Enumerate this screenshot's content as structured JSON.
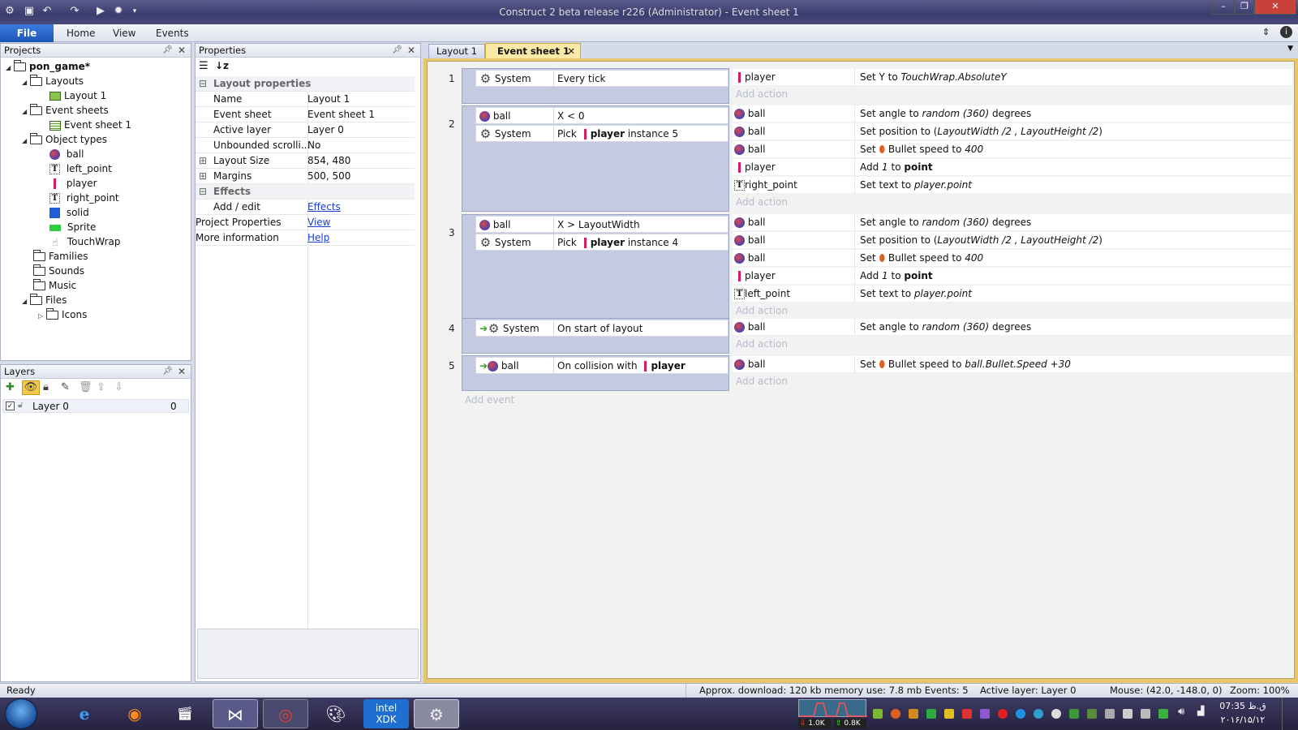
{
  "window": {
    "title": "Construct 2 beta release r226 (Administrator) - Event sheet 1",
    "min": "–",
    "max": "❐",
    "close": "✕"
  },
  "ribbon": {
    "file": "File",
    "tabs": [
      "Home",
      "View",
      "Events"
    ]
  },
  "projects": {
    "header": "Projects",
    "root": "pon_game*",
    "layouts_folder": "Layouts",
    "layout1": "Layout 1",
    "eventsheets_folder": "Event sheets",
    "eventsheet1": "Event sheet 1",
    "objecttypes_folder": "Object types",
    "objects": [
      "ball",
      "left_point",
      "player",
      "right_point",
      "solid",
      "Sprite",
      "TouchWrap"
    ],
    "families": "Families",
    "sounds": "Sounds",
    "music": "Music",
    "files": "Files",
    "icons": "Icons"
  },
  "layers": {
    "header": "Layers",
    "layer_name": "Layer 0",
    "layer_num": "0"
  },
  "properties": {
    "header": "Properties",
    "section_layout": "Layout properties",
    "rows": [
      {
        "k": "Name",
        "v": "Layout 1"
      },
      {
        "k": "Event sheet",
        "v": "Event sheet 1"
      },
      {
        "k": "Active layer",
        "v": "Layer 0"
      },
      {
        "k": "Unbounded scrolli...",
        "v": "No"
      },
      {
        "k": "Layout Size",
        "v": "854, 480"
      },
      {
        "k": "Margins",
        "v": "500, 500"
      }
    ],
    "section_effects": "Effects",
    "addedit": "Add / edit",
    "effects_link": "Effects",
    "project_props": "Project Properties",
    "view_link": "View",
    "more_info": "More information",
    "help_link": "Help"
  },
  "doc_tabs": [
    "Layout 1",
    "Event sheet 1"
  ],
  "events": {
    "add_action": "Add action",
    "add_event": "Add event",
    "e1": {
      "num": "1",
      "c1_obj": "System",
      "c1_txt": "Every tick",
      "a1_obj": "player",
      "a1_pre": "Set Y to ",
      "a1_it": "TouchWrap.AbsoluteY"
    },
    "e2": {
      "num": "2",
      "c1_obj": "ball",
      "c1_txt": "X < 0",
      "c2_obj": "System",
      "c2_pick": "Pick",
      "c2_b": "player",
      "c2_rest": " instance 5",
      "acts": [
        {
          "obj": "ball",
          "pre": "Set angle to ",
          "it": "random (360)",
          "post": "  degrees"
        },
        {
          "obj": "ball",
          "pre": "Set position to (",
          "it": "LayoutWidth /2 , LayoutHeight /2",
          "post": ")"
        },
        {
          "obj": "ball",
          "pre": "Set ",
          "mid": "Bullet speed to ",
          "it": "400",
          "post": ""
        },
        {
          "obj": "player",
          "pre": "Add ",
          "it": "1",
          "post": " to ",
          "b": "point"
        },
        {
          "obj": "right_point",
          "pre": "Set text to ",
          "it": "player.point",
          "post": ""
        }
      ]
    },
    "e3": {
      "num": "3",
      "c1_obj": "ball",
      "c1_txt": "X > LayoutWidth",
      "c2_obj": "System",
      "c2_pick": "Pick",
      "c2_b": "player",
      "c2_rest": " instance 4",
      "acts": [
        {
          "obj": "ball",
          "pre": "Set angle to ",
          "it": "random (360)",
          "post": "  degrees"
        },
        {
          "obj": "ball",
          "pre": "Set position to (",
          "it": "LayoutWidth /2 , LayoutHeight /2",
          "post": ")"
        },
        {
          "obj": "ball",
          "pre": "Set ",
          "mid": "Bullet speed to ",
          "it": "400",
          "post": ""
        },
        {
          "obj": "player",
          "pre": "Add ",
          "it": "1",
          "post": " to ",
          "b": "point"
        },
        {
          "obj": "left_point",
          "pre": "Set text to ",
          "it": "player.point",
          "post": ""
        }
      ]
    },
    "e4": {
      "num": "4",
      "c1_obj": "System",
      "c1_txt": "On start of layout",
      "a1_obj": "ball",
      "a1_pre": "Set angle to ",
      "a1_it": "random (360)",
      "a1_post": "  degrees"
    },
    "e5": {
      "num": "5",
      "c1_obj": "ball",
      "c1_txt": "On collision with",
      "c1_b": "player",
      "a1_obj": "ball",
      "a1_pre": "Set ",
      "a1_mid": "Bullet speed to ",
      "a1_it": "ball.Bullet.Speed +30"
    }
  },
  "status": {
    "ready": "Ready",
    "download": "Approx. download: 120 kb  memory use: 7.8 mb  Events: 5",
    "active_layer": "Active layer: Layer 0",
    "mouse": "Mouse: (42.0, -148.0, 0)",
    "zoom": "Zoom: 100%"
  },
  "taskbar": {
    "net_down": "1.0K",
    "net_up": "0.8K",
    "time": "07:35 ق.ظ",
    "date": "۲۰۱۶/۱۵/۱۲"
  },
  "colors": {
    "accent": "#1d55b8",
    "player_bar": "#d81b60",
    "link": "#1a3fd1"
  }
}
